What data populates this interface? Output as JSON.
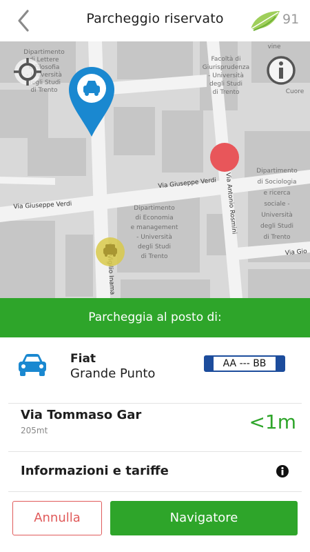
{
  "header": {
    "title": "Parcheggio riservato",
    "score": "91",
    "back_icon": "chevron-left-icon",
    "logo_icon": "leaf-icon"
  },
  "map": {
    "labels": {
      "dip_lettere": [
        "Dipartimento",
        "di Lettere",
        "e Filosofia",
        "- Università",
        "degli Studi",
        "di Trento"
      ],
      "facolta_giuri": [
        "Facoltà di",
        "Giurisprudenza",
        "- Università",
        "degli Studi",
        "di Trento"
      ],
      "dip_sociologia": [
        "Dipartimento",
        "di Sociologia",
        "e ricerca",
        "sociale -",
        "Università",
        "degli Studi",
        "di Trento"
      ],
      "dip_economia": [
        "Dipartimento",
        "di Economia",
        "e management",
        "- Università",
        "degli Studi",
        "di Trento"
      ],
      "via_verdi_1": "Via Giuseppe Verdi",
      "via_verdi_2": "Via Giuseppe Verdi",
      "via_rosmini": "Via Antonio Rosmini",
      "via_inama": "Via Vigilio Inama",
      "via_gio": "Via Gio",
      "cuore": "Cuore",
      "vine": "vine"
    },
    "icons": {
      "locate": "crosshair-icon",
      "info": "info-icon",
      "pin": "car-location-pin-icon"
    },
    "colors": {
      "pin": "#1a88d0",
      "destination": "#e8565a",
      "parked": "#d8c94a"
    }
  },
  "banner": {
    "text": "Parcheggia al posto di:"
  },
  "vehicle": {
    "brand": "Fiat",
    "model": "Grande Punto",
    "plate": "AA --- BB",
    "icon": "car-icon"
  },
  "destination": {
    "street": "Via Tommaso Gar",
    "distance": "205mt",
    "eta": "<1m"
  },
  "info": {
    "label": "Informazioni e tariffe",
    "icon": "info-circle-icon"
  },
  "actions": {
    "cancel": "Annulla",
    "navigate": "Navigatore"
  },
  "colors": {
    "accent": "#2ea52a",
    "cancel": "#e05a5a",
    "plate_blue": "#1c4c9c"
  }
}
